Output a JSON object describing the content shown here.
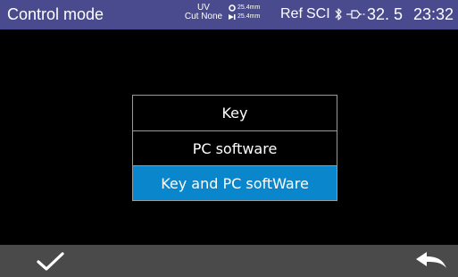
{
  "status_bar": {
    "title": "Control mode",
    "uv_label": "UV",
    "cut_label": "Cut None",
    "fiber_top": "25.4mm",
    "fiber_bottom": "25.4mm",
    "ref_label": "Ref",
    "sci_label": "SCI",
    "temperature": "32. 5",
    "time": "23:32",
    "bar_color": "#4a4a8e"
  },
  "menu": {
    "items": [
      {
        "label": "Key",
        "selected": false
      },
      {
        "label": "PC software",
        "selected": false
      },
      {
        "label": "Key and PC softWare",
        "selected": true
      }
    ],
    "selected_color": "#0a86cc"
  },
  "bottom_bar": {
    "confirm_icon": "checkmark-icon",
    "back_icon": "back-arrow-icon",
    "bar_color": "#4a4a4a"
  }
}
